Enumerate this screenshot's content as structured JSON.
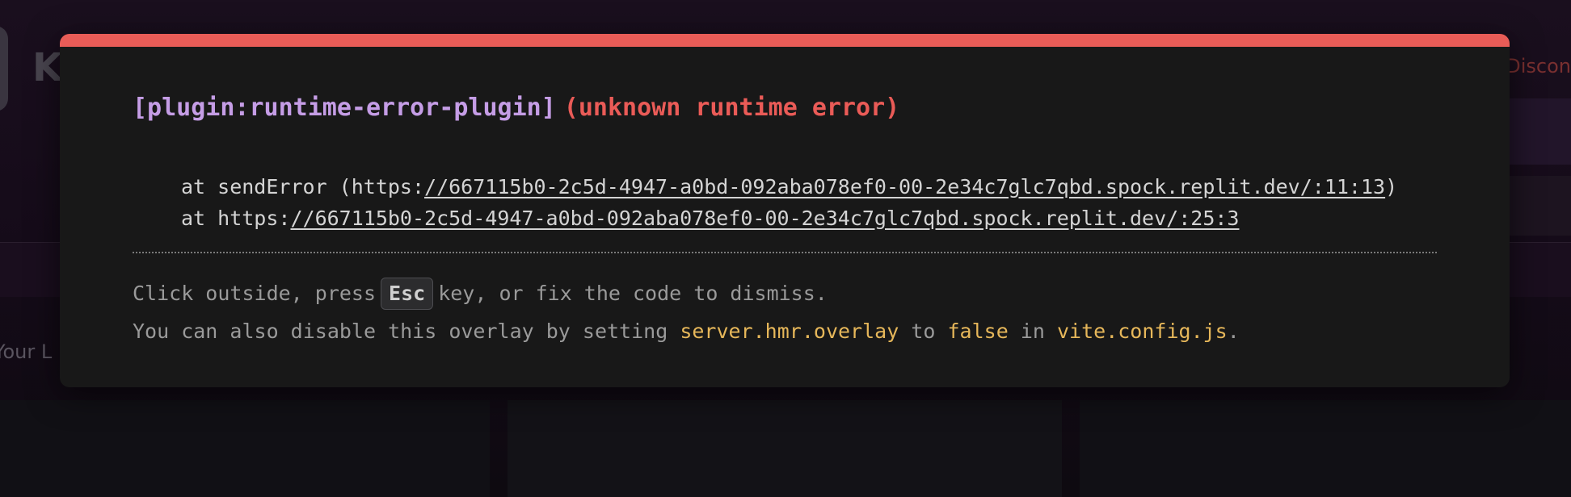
{
  "background": {
    "logo_letter": "K",
    "right_text": "Discon",
    "left_text": "Your L"
  },
  "overlay": {
    "accent_color": "#e85c57",
    "plugin": "[plugin:runtime-error-plugin]",
    "message": "(unknown runtime error)",
    "stack": [
      {
        "prefix": "at sendError (https:",
        "link": "//667115b0-2c5d-4947-a0bd-092aba078ef0-00-2e34c7glc7qbd.spock.replit.dev/:11:13",
        "suffix": ")"
      },
      {
        "prefix": "at https:",
        "link": "//667115b0-2c5d-4947-a0bd-092aba078ef0-00-2e34c7glc7qbd.spock.replit.dev/:25:3",
        "suffix": ""
      }
    ],
    "tip_line1": {
      "before": "Click outside, press",
      "key": "Esc",
      "after": "key, or fix the code to dismiss."
    },
    "tip_line2": {
      "part1": "You can also disable this overlay by setting",
      "code1": "server.hmr.overlay",
      "part2": "to",
      "code2": "false",
      "part3": "in",
      "code3": "vite.config.js",
      "part4": "."
    }
  }
}
